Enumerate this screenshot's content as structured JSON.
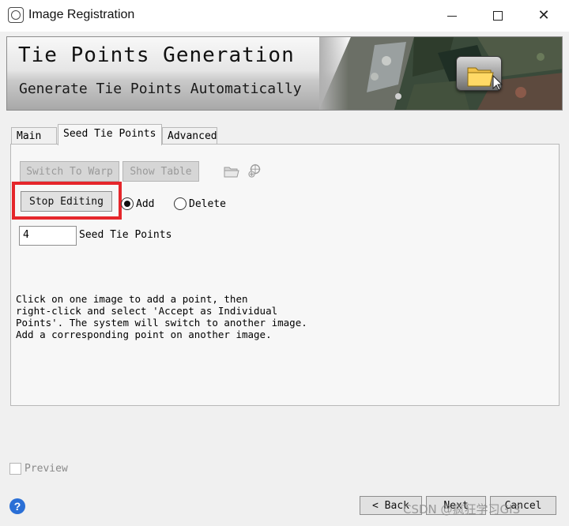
{
  "window": {
    "title": "Image Registration",
    "icon": "app-logo-icon",
    "controls": [
      "minimize-icon",
      "maximize-icon",
      "close-icon"
    ]
  },
  "banner": {
    "title": "Tie Points Generation",
    "subtitle": "Generate Tie Points Automatically",
    "icon": "folder-icon"
  },
  "tabs": [
    {
      "label": "Main",
      "active": false
    },
    {
      "label": "Seed Tie Points",
      "active": true
    },
    {
      "label": "Advanced",
      "active": false
    }
  ],
  "toolbar": {
    "switch_to_warp": "Switch To Warp",
    "show_table": "Show Table",
    "open_icon": "open-file-icon",
    "add_icon": "add-point-icon"
  },
  "editing": {
    "stop_editing": "Stop Editing",
    "add_label": "Add",
    "add_checked": true,
    "delete_label": "Delete",
    "delete_checked": false
  },
  "seed": {
    "value": "4",
    "label": "Seed Tie Points"
  },
  "instructions": "Click on one image to add a point, then\nright-click and select 'Accept as Individual\nPoints'. The system will switch to another image.\nAdd a corresponding point on another image.",
  "footer": {
    "preview_label": "Preview",
    "preview_checked": false,
    "back_label": "< Back",
    "next_label": "Next",
    "cancel_label": "Cancel",
    "help_icon": "help-icon"
  },
  "watermark": "CSDN @疯狂学习GIS",
  "colors": {
    "highlight": "#e5262b",
    "background": "#f0f0f0"
  }
}
